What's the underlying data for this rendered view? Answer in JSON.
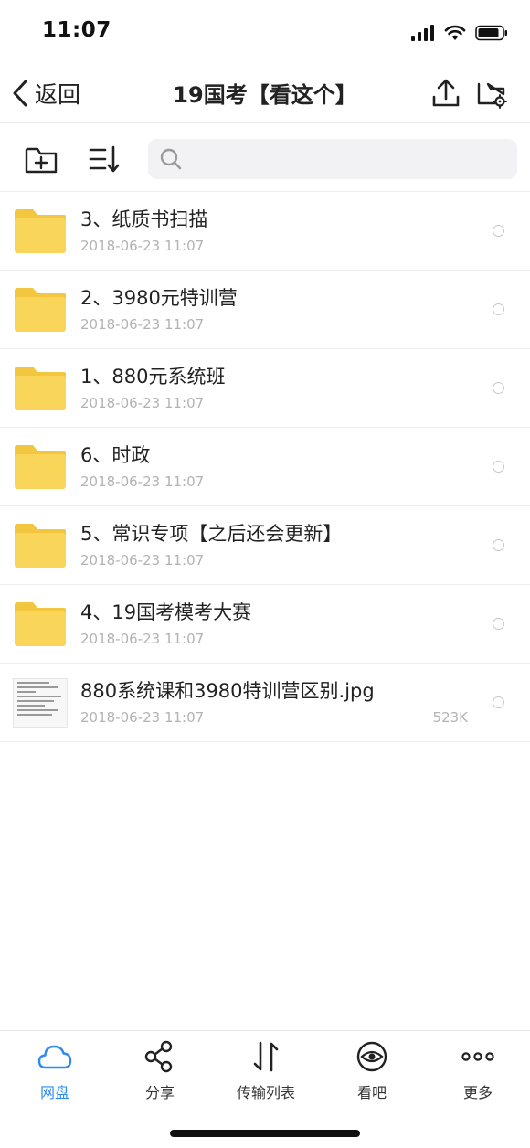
{
  "status_bar": {
    "time": "11:07"
  },
  "nav": {
    "back_label": "返回",
    "title": "19国考【看这个】"
  },
  "search": {
    "placeholder": ""
  },
  "files": [
    {
      "name": "3、纸质书扫描",
      "date": "2018-06-23 11:07",
      "type": "folder",
      "size": ""
    },
    {
      "name": "2、3980元特训营",
      "date": "2018-06-23 11:07",
      "type": "folder",
      "size": ""
    },
    {
      "name": "1、880元系统班",
      "date": "2018-06-23 11:07",
      "type": "folder",
      "size": ""
    },
    {
      "name": "6、时政",
      "date": "2018-06-23 11:07",
      "type": "folder",
      "size": ""
    },
    {
      "name": "5、常识专项【之后还会更新】",
      "date": "2018-06-23 11:07",
      "type": "folder",
      "size": ""
    },
    {
      "name": "4、19国考模考大赛",
      "date": "2018-06-23 11:07",
      "type": "folder",
      "size": ""
    },
    {
      "name": "880系统课和3980特训营区别.jpg",
      "date": "2018-06-23 11:07",
      "type": "image",
      "size": "523K"
    }
  ],
  "tabs": [
    {
      "label": "网盘",
      "icon": "cloud-icon",
      "active": true
    },
    {
      "label": "分享",
      "icon": "share-icon",
      "active": false
    },
    {
      "label": "传输列表",
      "icon": "transfer-icon",
      "active": false
    },
    {
      "label": "看吧",
      "icon": "eye-icon",
      "active": false
    },
    {
      "label": "更多",
      "icon": "more-icon",
      "active": false
    }
  ],
  "colors": {
    "accent": "#2e8cf0",
    "folder": "#f9d55a",
    "folder_tab": "#f3c63f"
  }
}
